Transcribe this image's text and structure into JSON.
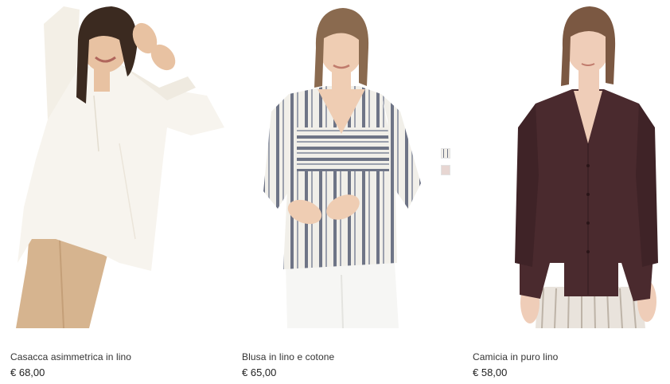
{
  "products": [
    {
      "name": "Casacca asimmetrica in lino",
      "price": "€ 68,00",
      "colors": {
        "top": "#f7f4ee",
        "bottom": "#d6b48f",
        "hair": "#3b2a20",
        "skin": "#e8c2a2"
      }
    },
    {
      "name": "Blusa in lino e cotone",
      "price": "€ 65,00",
      "colors": {
        "top": "#f1efe9",
        "stripe": "#6e7486",
        "bottom": "#f6f6f4",
        "hair": "#8a6a4f",
        "skin": "#efcdb3"
      }
    },
    {
      "name": "Camicia in puro lino",
      "price": "€ 58,00",
      "colors": {
        "top": "#4a2a2e",
        "bottom": "#e9e3dc",
        "hair": "#7b5842",
        "skin": "#efcdb8"
      }
    }
  ],
  "swatches": [
    {
      "name": "striped",
      "color": "#6e7486"
    },
    {
      "name": "rose",
      "color": "#e7d6d2"
    }
  ]
}
